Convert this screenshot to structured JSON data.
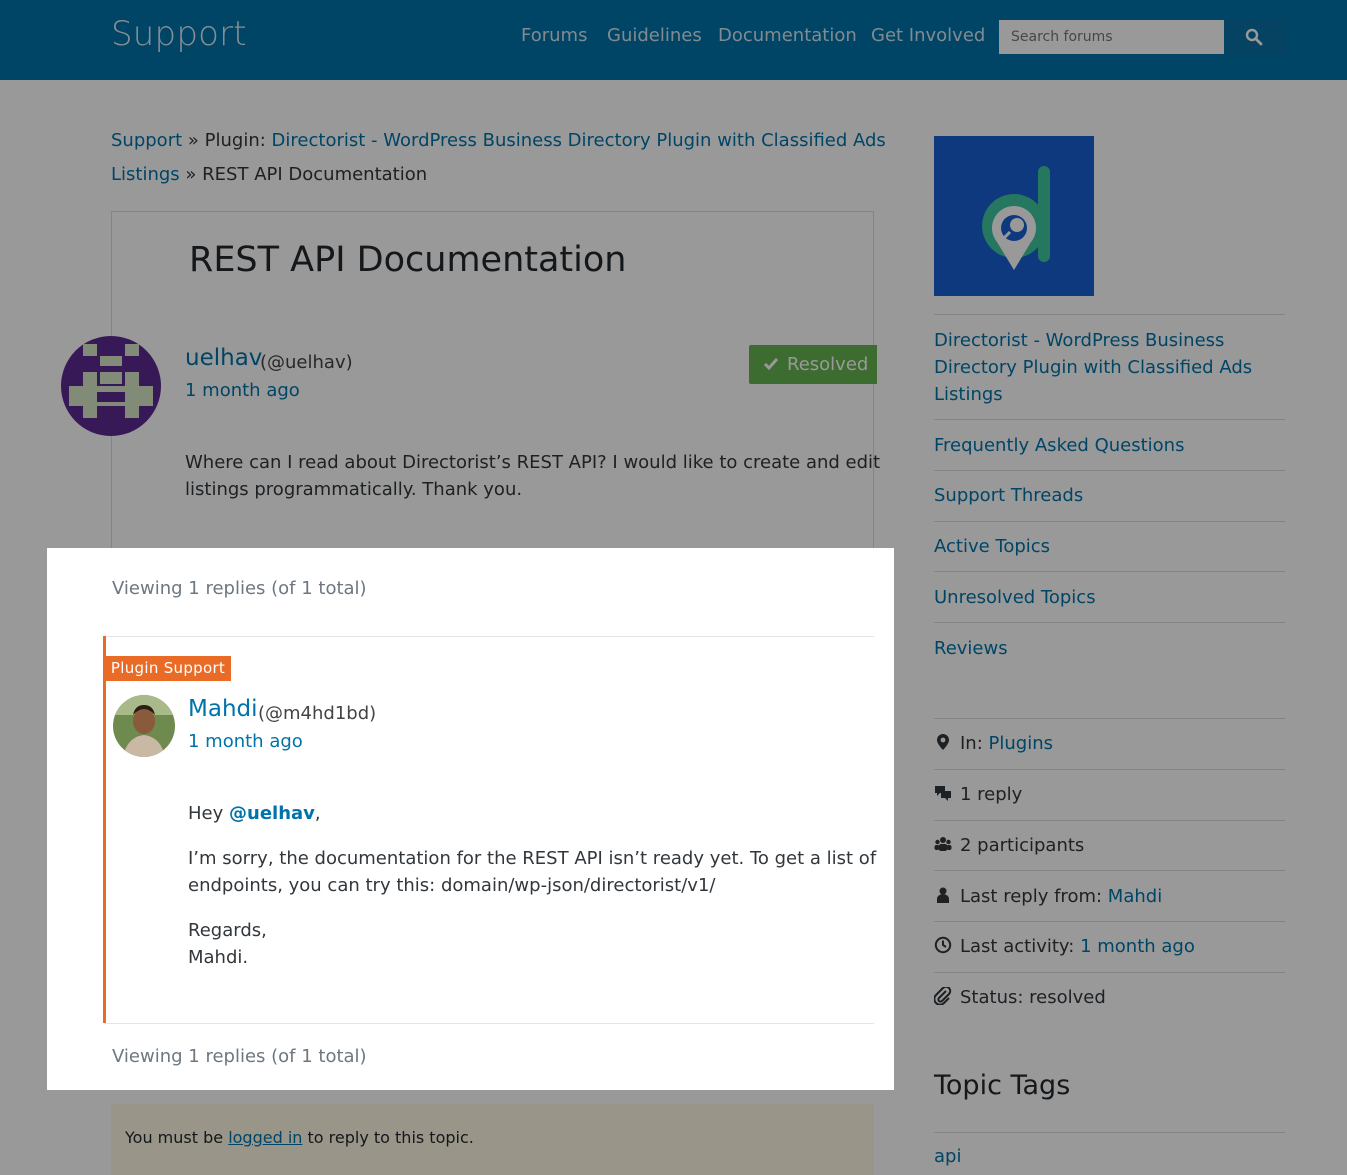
{
  "header": {
    "site_title": "Support",
    "nav": [
      "Forums",
      "Guidelines",
      "Documentation",
      "Get Involved"
    ],
    "search_placeholder": "Search forums"
  },
  "breadcrumb": {
    "root": "Support",
    "sep1": "»",
    "plugin_prefix": "Plugin:",
    "plugin_line1": "Directorist - WordPress Business Directory Plugin with Classified Ads",
    "plugin_line2": "Listings",
    "sep2": "»",
    "current": "REST API Documentation"
  },
  "topic": {
    "title": "REST API Documentation",
    "author": "uelhav",
    "handle": "(@uelhav)",
    "time": "1 month ago",
    "status_label": "Resolved",
    "body_line1": "Where can I read about Directorist’s REST API? I would like to create and edit",
    "body_line2": "listings programmatically. Thank you."
  },
  "replies": {
    "viewing": "Viewing 1 replies (of 1 total)",
    "badge": "Plugin Support",
    "author": "Mahdi",
    "handle": "(@m4hd1bd)",
    "time": "1 month ago",
    "greeting": "Hey",
    "mention": "@uelhav",
    "greeting_end": ",",
    "para_line1": "I’m sorry, the documentation for the REST API isn’t ready yet. To get a list of",
    "para_line2": "endpoints, you can try this: domain/wp-json/directorist/v1/",
    "sign1": "Regards,",
    "sign2": "Mahdi."
  },
  "notice": {
    "before": "You must be",
    "link": "logged in",
    "after": "to reply to this topic."
  },
  "sidebar": {
    "plugin_name": "Directorist - WordPress Business Directory Plugin with Classified Ads Listings",
    "links": [
      "Frequently Asked Questions",
      "Support Threads",
      "Active Topics",
      "Unresolved Topics",
      "Reviews"
    ],
    "meta": {
      "in_label": "In:",
      "in_value": "Plugins",
      "replies": "1 reply",
      "participants": "2 participants",
      "last_reply_label": "Last reply from:",
      "last_reply_value": "Mahdi",
      "last_activity_label": "Last activity:",
      "last_activity_value": "1 month ago",
      "status": "Status: resolved"
    },
    "tags_heading": "Topic Tags",
    "tags": [
      "api"
    ]
  },
  "colors": {
    "header_bg": "#0073aa",
    "link": "#0073aa",
    "resolved": "#64b450",
    "plugin_support": "#ea6b26",
    "logo_bg": "#1a5fd3"
  }
}
